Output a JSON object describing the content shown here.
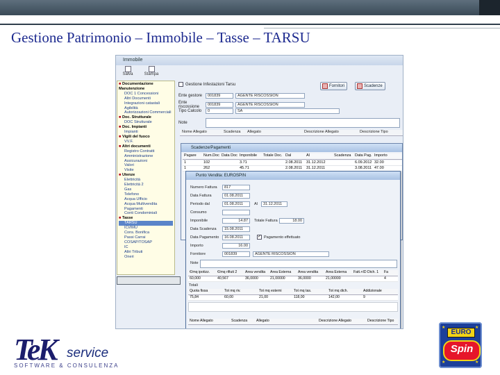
{
  "slide": {
    "title": "Gestione Patrimonio – Immobile – Tasse – TARSU"
  },
  "main_window": {
    "title": "Immobile",
    "toolbar": [
      "Salva",
      "Stampa"
    ],
    "checkbox_label": "Gestione Infestazioni Tarsu",
    "buttons": {
      "fornitori": "Fornitori",
      "scadenze": "Scadenze"
    },
    "fields": [
      {
        "label": "Ente gestore",
        "value": "001839",
        "value2": "AGENTE RISCOSSION"
      },
      {
        "label": "Ente riscossione",
        "value": "001839",
        "value2": "AGENTE RISCOSSION"
      },
      {
        "label": "Tipo Calcolo",
        "value": "0",
        "value2": "SA"
      }
    ],
    "note_label": "Note",
    "grid_headers": [
      "Nome Allegato",
      "Scadenza",
      "Allegato",
      "Descrizione Allegato",
      "Descrizione Tipo"
    ],
    "tree": [
      {
        "t": "Documentazione Manutenzione",
        "g": true
      },
      {
        "t": "DOC 1 Concessioni"
      },
      {
        "t": "Altri Documenti"
      },
      {
        "t": "Integrazioni catastali"
      },
      {
        "t": "Agibilità"
      },
      {
        "t": "Autorizzazioni Commerciali"
      },
      {
        "t": "Doc. Strutturale",
        "g": true
      },
      {
        "t": "DOC Strutturale"
      },
      {
        "t": "Doc. Impianti",
        "g": true
      },
      {
        "t": "Impianti"
      },
      {
        "t": "Vigili del fuoco",
        "g": true
      },
      {
        "t": "VV.F."
      },
      {
        "t": "Altri documenti",
        "g": true
      },
      {
        "t": "Registro Contratti"
      },
      {
        "t": "Amministrazione"
      },
      {
        "t": "Assicurazioni"
      },
      {
        "t": "Valori"
      },
      {
        "t": "Visite"
      },
      {
        "t": "Utenze",
        "g": true
      },
      {
        "t": "Elettricità"
      },
      {
        "t": "Elettricità 2"
      },
      {
        "t": "Gas"
      },
      {
        "t": "Telefono"
      },
      {
        "t": "Acqua Ufficio"
      },
      {
        "t": "Acqua Multivendita"
      },
      {
        "t": "Pagamenti"
      },
      {
        "t": "Conti Condominiali"
      },
      {
        "t": "Tasse",
        "g": true
      },
      {
        "t": "TARSU",
        "sel": true
      },
      {
        "t": "ICI/IMU"
      },
      {
        "t": "Cons. Bonifica"
      },
      {
        "t": "Passi Carrai"
      },
      {
        "t": "COSAP/TOSAP"
      },
      {
        "t": "IC"
      },
      {
        "t": "Altri Tributi"
      },
      {
        "t": "Oneri"
      }
    ]
  },
  "win_scadenze": {
    "title": "Scadenze/Pagamenti",
    "headers": [
      "Pagare",
      "Num.Doc",
      "Data Doc",
      "Imponibile",
      "Totale Doc.",
      "Dal",
      "Al",
      "Scadenza",
      "Data Pag.",
      "Importo"
    ],
    "rows": [
      [
        "1",
        "102",
        "",
        "3.71",
        "",
        "2.08.2011",
        "31.12.2012",
        "",
        "6.09.2012",
        "32.00"
      ],
      [
        "1",
        "262",
        "",
        "45.71",
        "",
        "2.08.2011",
        "31.12.2011",
        "",
        "3.08.2011",
        "47.00"
      ]
    ]
  },
  "win_pv": {
    "title": "Punto Vendita:",
    "title_value": "EUROSPIN",
    "labels": [
      "Numero Fattura",
      "Data Fattura",
      "Periodo dal",
      "Consumo",
      "Imponibile",
      "Data Scadenza",
      "Data Pagamento",
      "Importo",
      "Fornitore",
      "Note"
    ],
    "values": {
      "numero_fattura": "817",
      "data_fattura": "01.08.2011",
      "periodo_dal": "01.08.2011",
      "al_label": "Al",
      "al_value": "31.12.2011",
      "imponibile": "14.87",
      "totale_label": "Totale Fattura",
      "totale_value": "18.00",
      "data_scadenza": "15.08.2011",
      "data_pagamento": "16.08.2011",
      "pagamento_label": "Pagamento effettuato",
      "importo": "16.00",
      "fornitore_code": "001839",
      "fornitore_name": "AGENTE RISCOSSION"
    },
    "table1_headers": [
      "€/mq ipotizz.",
      "€/mq rifiuti 2",
      "Area vendita",
      "Area Esterna",
      "Area vendita",
      "Area Esterna",
      "Fatt.+ID Dich. 1",
      "Fa"
    ],
    "table1_row": [
      "60,000",
      "40,567",
      "36,0000",
      "21,00000",
      "36,0000",
      "21,00000",
      "",
      "4"
    ],
    "sub_label": "Totali",
    "table2_headers": [
      "Quota fissa",
      "Tot mq riv.",
      "Tot mq esterni",
      "Tot mq tas.",
      "Tot mq dich.",
      "Addizionale"
    ],
    "table2_row": [
      "75,84",
      "60,00",
      "21,00",
      "118,00",
      "142,00",
      "9"
    ],
    "grid_headers": [
      "Nome Allegato",
      "Scadenza",
      "Allegato",
      "Descrizione Allegato",
      "Descrizione Tipo"
    ]
  },
  "logos": {
    "tek_mark": "TeK",
    "tek_service": "service",
    "tek_subtitle": "SOFTWARE & CONSULENZA",
    "euro": "EURO",
    "spin": "Spin"
  },
  "colors": {
    "title_blue": "#1d2a8f",
    "topbar": "#3a4a57"
  }
}
